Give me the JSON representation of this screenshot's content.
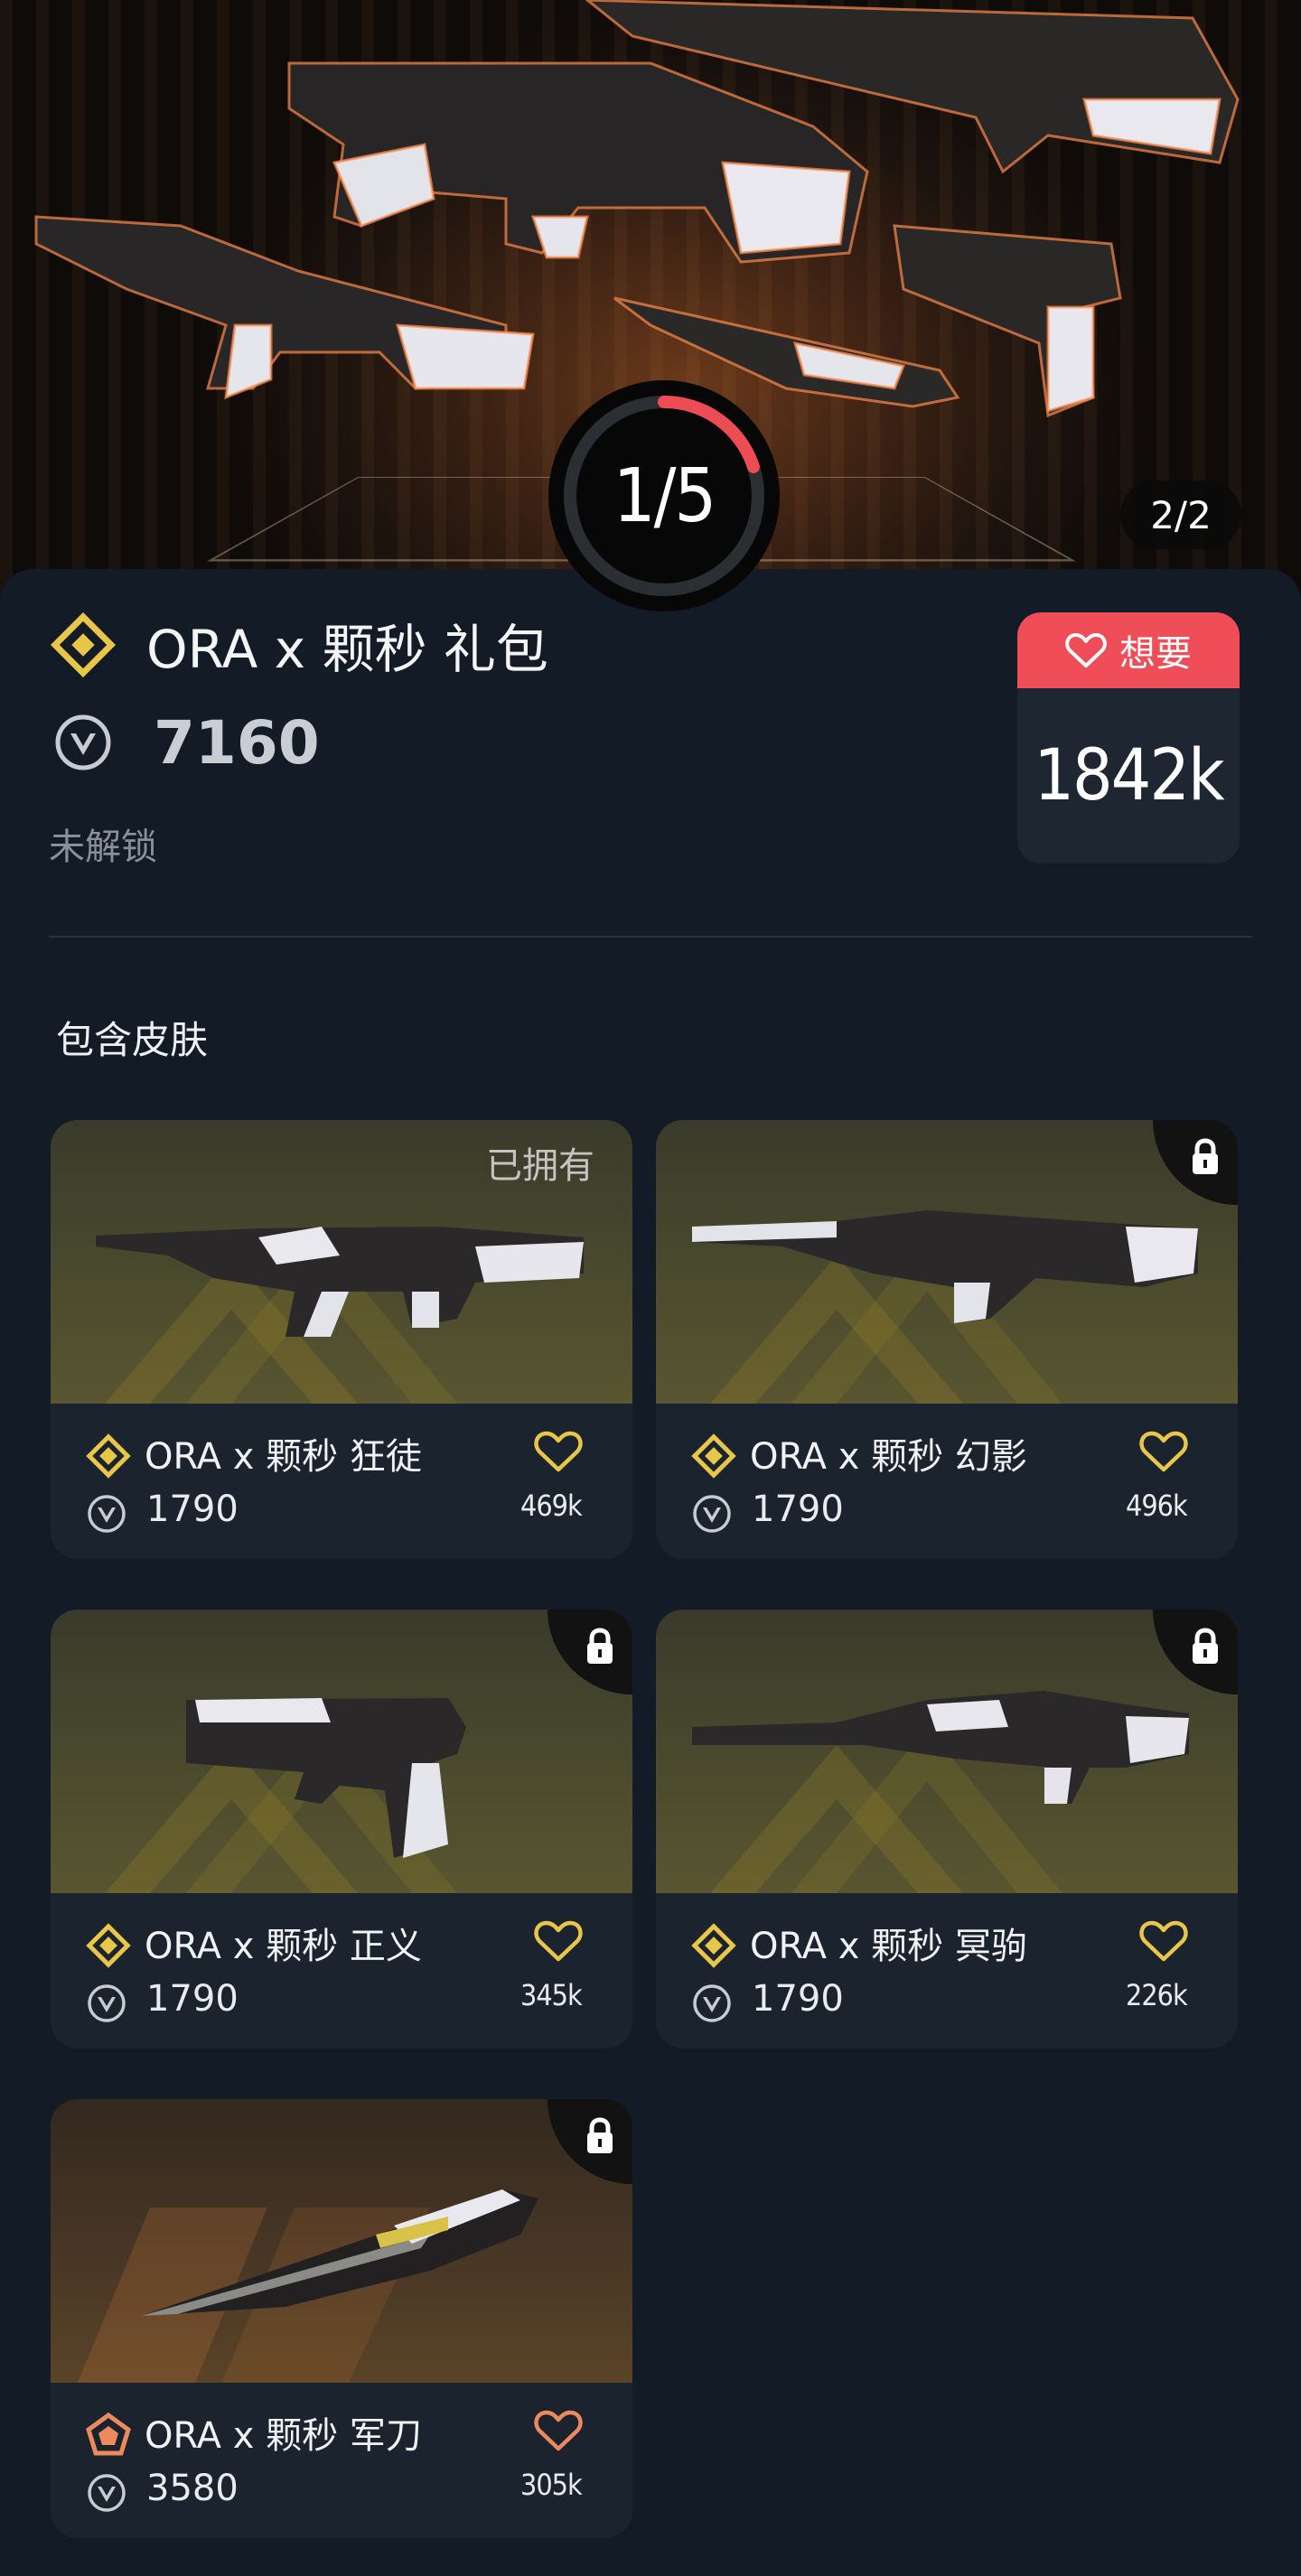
{
  "hero": {
    "page_counter": "2/2",
    "progress_text": "1/5",
    "progress_fraction": 0.2
  },
  "bundle": {
    "title": "ORA x 颗秒 礼包",
    "price": "7160",
    "lock_status": "未解锁",
    "want_label": "想要",
    "want_count": "1842k"
  },
  "section_title": "包含皮肤",
  "colors": {
    "accent_red": "#ef4d58",
    "tier_gold": "#e8c64a",
    "tier_orange": "#ec8a5e",
    "panel_bg": "#121b26",
    "card_bg": "#1a232e"
  },
  "skins": [
    {
      "name": "ORA x 颗秒 狂徒",
      "price": "1790",
      "likes": "469k",
      "owned_label": "已拥有",
      "tier": "gold",
      "gun": "rifle"
    },
    {
      "name": "ORA x 颗秒 幻影",
      "price": "1790",
      "likes": "496k",
      "owned_label": "",
      "tier": "gold",
      "gun": "rifle2"
    },
    {
      "name": "ORA x 颗秒 正义",
      "price": "1790",
      "likes": "345k",
      "owned_label": "",
      "tier": "gold",
      "gun": "pistol"
    },
    {
      "name": "ORA x 颗秒 冥驹",
      "price": "1790",
      "likes": "226k",
      "owned_label": "",
      "tier": "gold",
      "gun": "sniper"
    },
    {
      "name": "ORA x 颗秒 军刀",
      "price": "3580",
      "likes": "305k",
      "owned_label": "",
      "tier": "orange",
      "gun": "knife"
    }
  ],
  "icons": {
    "bundle_tier": "gold-diamond-icon",
    "currency": "valorant-points-icon",
    "want": "heart-icon",
    "locked": "padlock-icon"
  }
}
